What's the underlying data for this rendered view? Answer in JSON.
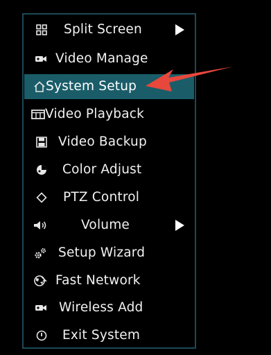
{
  "menu": {
    "accent_color": "#1a5d69",
    "border_color": "#1b4a57",
    "items": [
      {
        "label": "Split Screen",
        "icon": "grid-icon",
        "has_submenu": true,
        "selected": false
      },
      {
        "label": "Video Manage",
        "icon": "camera-icon",
        "has_submenu": false,
        "selected": false
      },
      {
        "label": "System Setup",
        "icon": "home-icon",
        "has_submenu": false,
        "selected": true
      },
      {
        "label": "Video Playback",
        "icon": "film-icon",
        "has_submenu": false,
        "selected": false
      },
      {
        "label": "Video Backup",
        "icon": "floppy-disk-icon",
        "has_submenu": false,
        "selected": false
      },
      {
        "label": "Color Adjust",
        "icon": "palette-icon",
        "has_submenu": false,
        "selected": false
      },
      {
        "label": "PTZ Control",
        "icon": "diamond-icon",
        "has_submenu": false,
        "selected": false
      },
      {
        "label": "Volume",
        "icon": "speaker-icon",
        "has_submenu": true,
        "selected": false
      },
      {
        "label": "Setup Wizard",
        "icon": "gears-icon",
        "has_submenu": false,
        "selected": false
      },
      {
        "label": "Fast Network",
        "icon": "globe-icon",
        "has_submenu": false,
        "selected": false
      },
      {
        "label": "Wireless Add",
        "icon": "camera-icon",
        "has_submenu": false,
        "selected": false
      },
      {
        "label": "Exit System",
        "icon": "power-icon",
        "has_submenu": false,
        "selected": false
      }
    ]
  },
  "pointer_color": "#e8473c"
}
